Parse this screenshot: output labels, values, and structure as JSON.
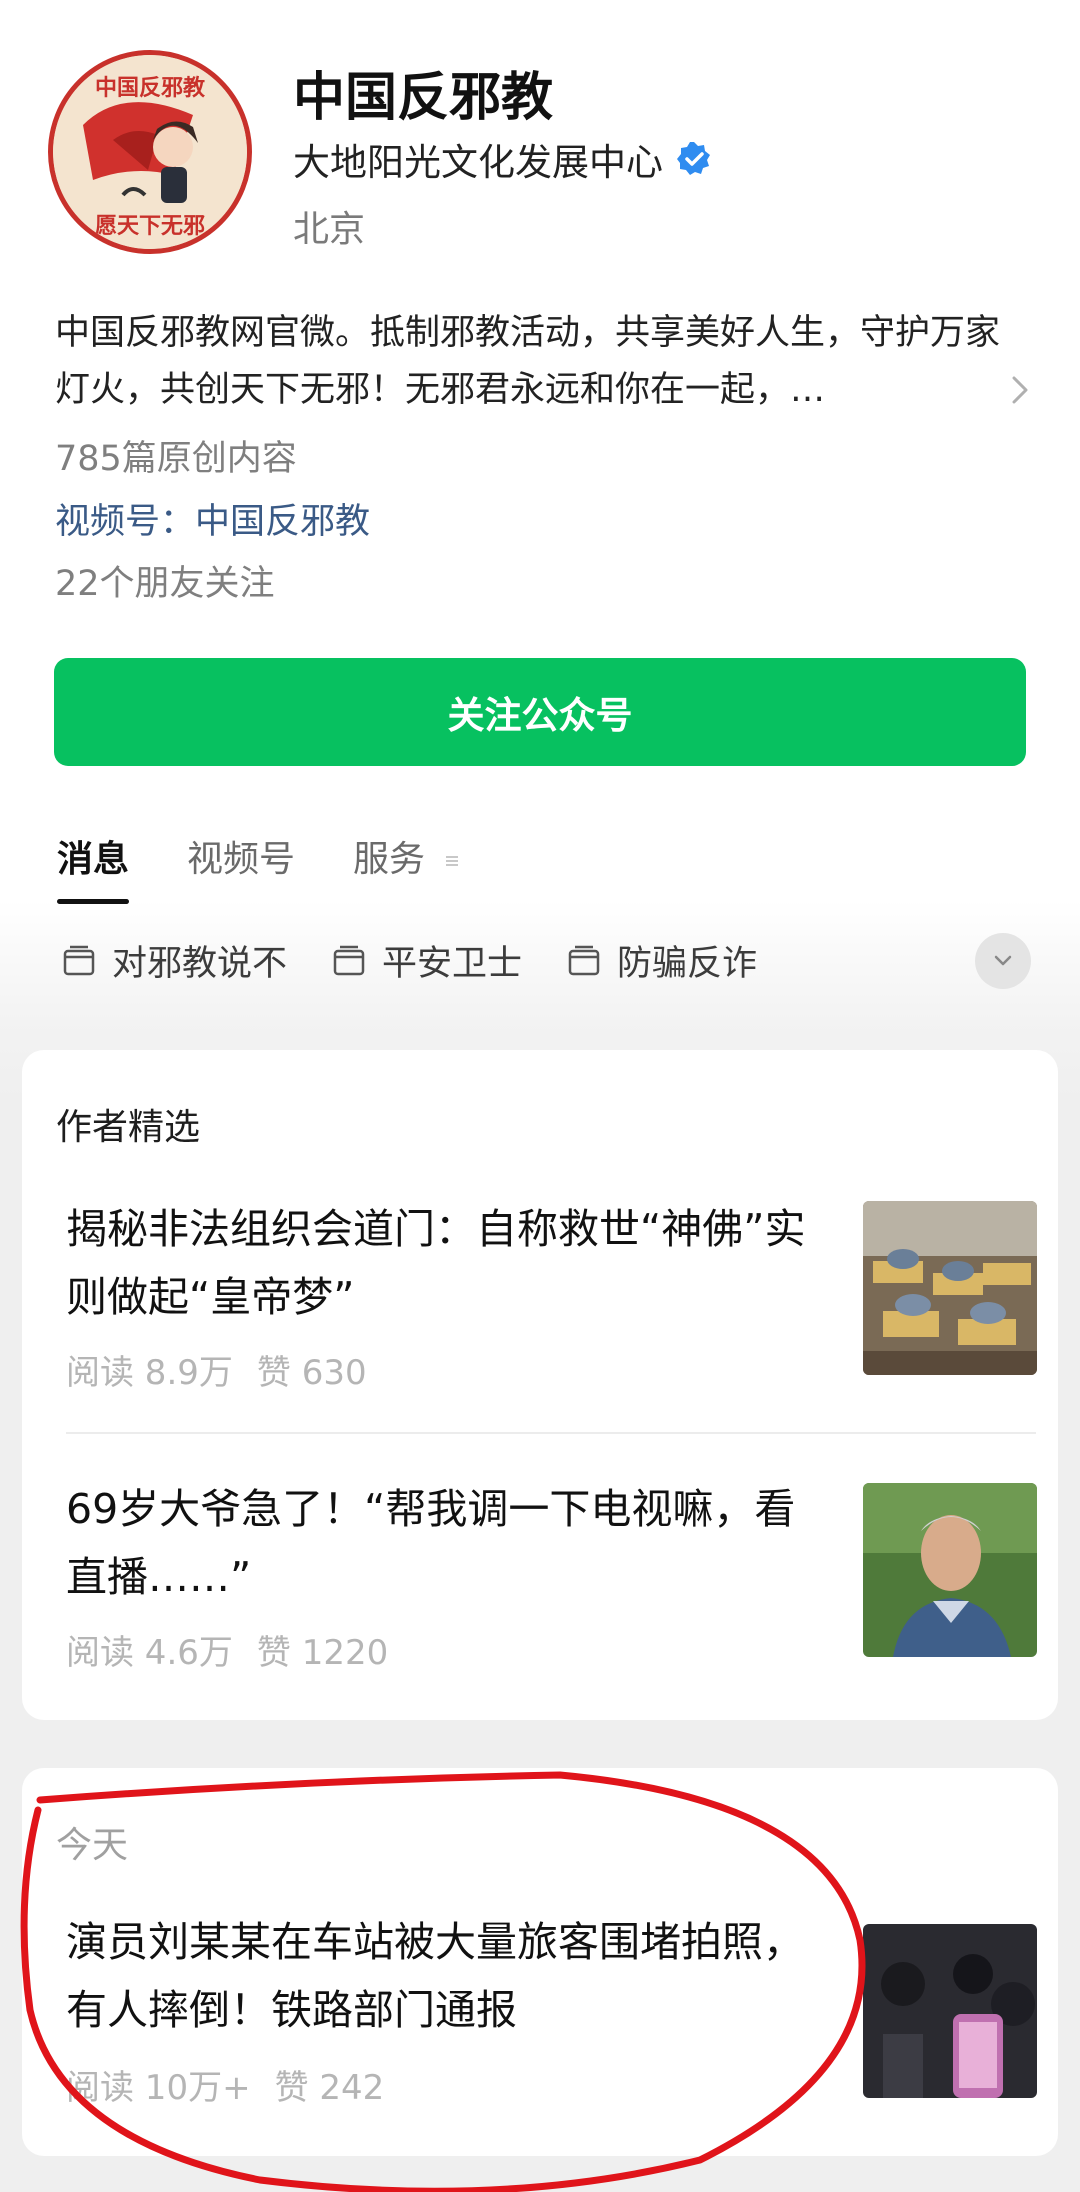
{
  "header": {
    "title": "中国反邪教",
    "organization": "大地阳光文化发展中心",
    "location": "北京",
    "avatar_text_top": "中国反邪教",
    "avatar_text_bottom": "愿天下无邪"
  },
  "bio": {
    "text": "中国反邪教网官微。抵制邪教活动，共享美好人生，守护万家灯火，共创天下无邪！无邪君永远和你在一起，…",
    "original_count": "785篇原创内容",
    "channel_prefix": "视频号：",
    "channel_name": "中国反邪教",
    "friends": "22个朋友关注"
  },
  "follow_button": {
    "label": "关注公众号"
  },
  "tabs": [
    {
      "label": "消息",
      "active": true
    },
    {
      "label": "视频号",
      "active": false
    },
    {
      "label": "服务",
      "active": false
    }
  ],
  "collections": [
    {
      "label": "对邪教说不",
      "icon": "folder-icon"
    },
    {
      "label": "平安卫士",
      "icon": "folder-icon"
    },
    {
      "label": "防骗反诈",
      "icon": "folder-icon"
    }
  ],
  "featured": {
    "label": "作者精选",
    "articles": [
      {
        "title": "揭秘非法组织会道门：自称救世“神佛”实则做起“皇帝梦”",
        "reads": "阅读 8.9万",
        "likes": "赞 630"
      },
      {
        "title": "69岁大爷急了！“帮我调一下电视嘛，看直播……”",
        "reads": "阅读 4.6万",
        "likes": "赞 1220"
      }
    ]
  },
  "today": {
    "label": "今天",
    "articles": [
      {
        "title": "演员刘某某在车站被大量旅客围堵拍照，有人摔倒！铁路部门通报",
        "reads": "阅读 10万+",
        "likes": "赞 242"
      }
    ]
  },
  "colors": {
    "accent_green": "#07c160",
    "link_blue": "#3a5a86",
    "annotation_red": "#e0141a"
  }
}
